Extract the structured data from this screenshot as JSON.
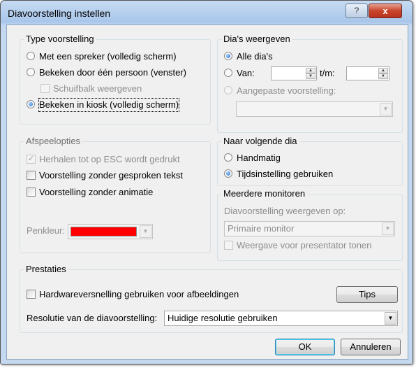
{
  "window": {
    "title": "Diavoorstelling instellen",
    "help_label": "?",
    "close_label": "x"
  },
  "type_voorstelling": {
    "legend": "Type voorstelling",
    "options": [
      {
        "label": "Met een spreker (volledig scherm)",
        "selected": false
      },
      {
        "label": "Bekeken door één persoon (venster)",
        "selected": false
      },
      {
        "label": "Bekeken in kiosk (volledig scherm)",
        "selected": true
      }
    ],
    "schuifbalk": {
      "label": "Schuifbalk weergeven",
      "checked": false,
      "disabled": true
    }
  },
  "dias_weergeven": {
    "legend": "Dia's weergeven",
    "alle": {
      "label": "Alle dia's",
      "selected": true
    },
    "van": {
      "label": "Van:",
      "selected": false,
      "from_value": "",
      "tm_label": "t/m:",
      "to_value": ""
    },
    "aangepast": {
      "label": "Aangepaste voorstelling:",
      "selected": false,
      "disabled": true,
      "value": ""
    }
  },
  "afspeelopties": {
    "legend": "Afspeelopties",
    "options": [
      {
        "label": "Herhalen tot op ESC wordt gedrukt",
        "checked": true,
        "disabled": true
      },
      {
        "label": "Voorstelling zonder gesproken tekst",
        "checked": false,
        "disabled": false
      },
      {
        "label": "Voorstelling zonder animatie",
        "checked": false,
        "disabled": false
      }
    ],
    "penkleur": {
      "label": "Penkleur:",
      "color": "#ff0000"
    }
  },
  "naar_volgende_dia": {
    "legend": "Naar volgende dia",
    "options": [
      {
        "label": "Handmatig",
        "selected": false
      },
      {
        "label": "Tijdsinstelling gebruiken",
        "selected": true
      }
    ]
  },
  "meerdere_monitoren": {
    "legend": "Meerdere monitoren",
    "weergeven_op_label": "Diavoorstelling weergeven op:",
    "monitor_value": "Primaire monitor",
    "presentator": {
      "label": "Weergave voor presentator tonen",
      "checked": false
    }
  },
  "prestaties": {
    "legend": "Prestaties",
    "hardware": {
      "label": "Hardwareversnelling gebruiken voor afbeeldingen",
      "checked": false
    },
    "tips_label": "Tips",
    "resolutie_label": "Resolutie van de diavoorstelling:",
    "resolutie_value": "Huidige resolutie gebruiken"
  },
  "footer": {
    "ok_label": "OK",
    "cancel_label": "Annuleren"
  },
  "icons": {
    "dropdown": "chevron-down-icon",
    "spin_up": "spin-up-icon",
    "spin_down": "spin-down-icon",
    "check": "checkmark-icon"
  }
}
